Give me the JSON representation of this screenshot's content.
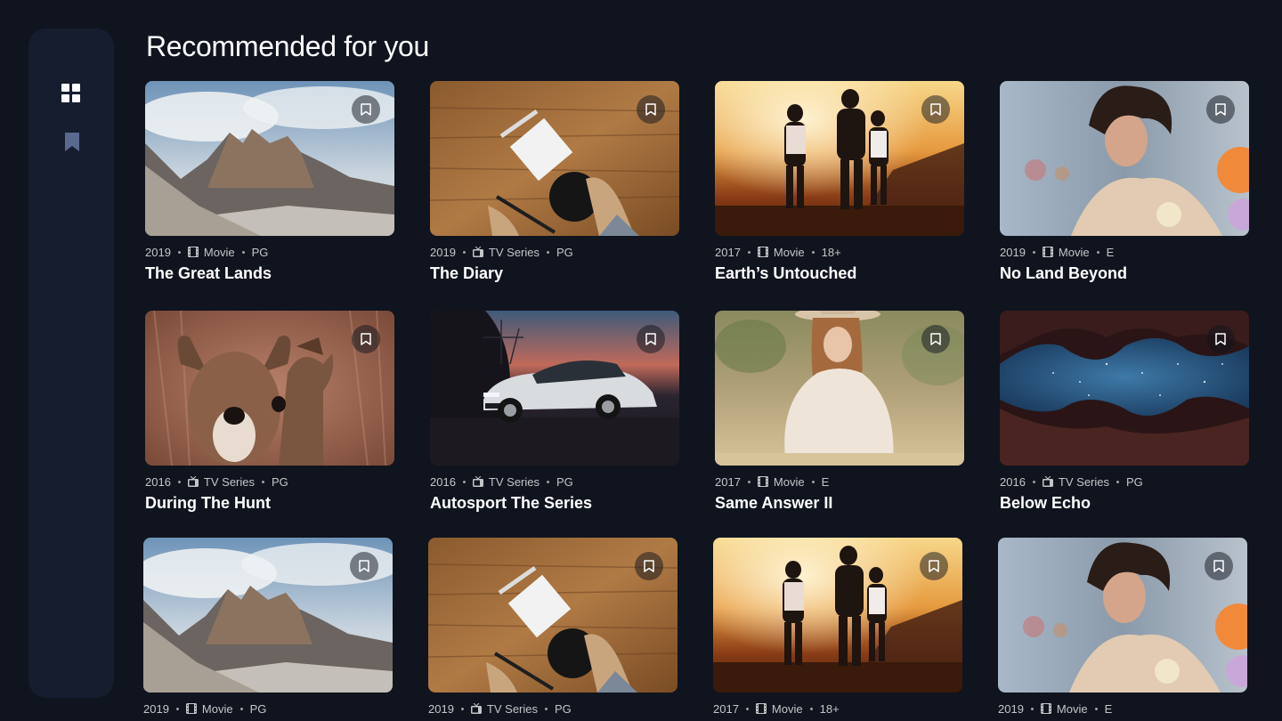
{
  "page": {
    "title": "Recommended for you"
  },
  "sidebar": {
    "items": [
      {
        "icon": "grid-icon",
        "label": "Home",
        "active": true,
        "color": "#ffffff"
      },
      {
        "icon": "bookmark-icon",
        "label": "Bookmarked",
        "active": false,
        "color": "#5a698f"
      }
    ]
  },
  "colors": {
    "background": "#10141e",
    "sidebar": "#161d2f",
    "inactive_icon": "#5a698f",
    "text": "#ffffff"
  },
  "cards": [
    {
      "year": "2019",
      "category": "Movie",
      "category_icon": "film-icon",
      "rating": "PG",
      "title": "The Great Lands",
      "thumbnail": "mountain-peaks"
    },
    {
      "year": "2019",
      "category": "TV Series",
      "category_icon": "tv-icon",
      "rating": "PG",
      "title": "The Diary",
      "thumbnail": "wooden-desk-notebook"
    },
    {
      "year": "2017",
      "category": "Movie",
      "category_icon": "film-icon",
      "rating": "18+",
      "title": "Earth’s Untouched",
      "thumbnail": "friends-sunset"
    },
    {
      "year": "2019",
      "category": "Movie",
      "category_icon": "film-icon",
      "rating": "E",
      "title": "No Land Beyond",
      "thumbnail": "curly-hair-man"
    },
    {
      "year": "2016",
      "category": "TV Series",
      "category_icon": "tv-icon",
      "rating": "PG",
      "title": "During The Hunt",
      "thumbnail": "deer"
    },
    {
      "year": "2016",
      "category": "TV Series",
      "category_icon": "tv-icon",
      "rating": "PG",
      "title": "Autosport The Series",
      "thumbnail": "white-car-dusk"
    },
    {
      "year": "2017",
      "category": "Movie",
      "category_icon": "film-icon",
      "rating": "E",
      "title": "Same Answer II",
      "thumbnail": "woman-hat-field"
    },
    {
      "year": "2016",
      "category": "TV Series",
      "category_icon": "tv-icon",
      "rating": "PG",
      "title": "Below Echo",
      "thumbnail": "canyon-stars"
    },
    {
      "year": "2019",
      "category": "Movie",
      "category_icon": "film-icon",
      "rating": "PG",
      "title": "",
      "thumbnail": "mountain-peaks"
    },
    {
      "year": "2019",
      "category": "TV Series",
      "category_icon": "tv-icon",
      "rating": "PG",
      "title": "",
      "thumbnail": "wooden-desk-notebook"
    },
    {
      "year": "2017",
      "category": "Movie",
      "category_icon": "film-icon",
      "rating": "18+",
      "title": "",
      "thumbnail": "friends-sunset"
    },
    {
      "year": "2019",
      "category": "Movie",
      "category_icon": "film-icon",
      "rating": "E",
      "title": "",
      "thumbnail": "curly-hair-man"
    }
  ]
}
